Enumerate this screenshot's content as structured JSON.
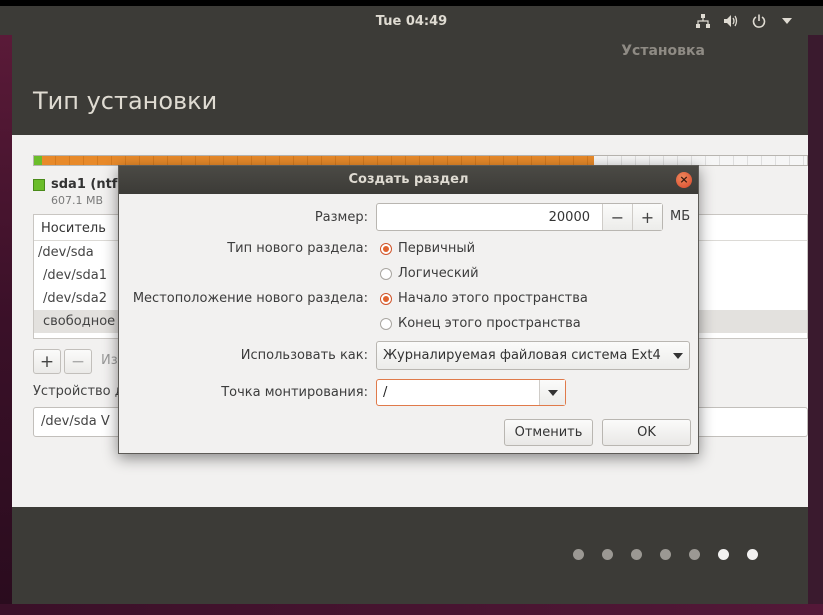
{
  "top_panel": {
    "clock": "Tue 04:49",
    "tray": [
      "network-icon",
      "volume-icon",
      "power-icon",
      "chevron-down-icon"
    ]
  },
  "installer": {
    "app_title": "Установка",
    "page_title": "Тип установки"
  },
  "partitions": {
    "legend_name": "sda1 (ntfs",
    "legend_size": "607.1 MB",
    "table_header": "Носитель",
    "rows": [
      "/dev/sda",
      "/dev/sda1",
      "/dev/sda2",
      "свободное"
    ],
    "add_label": "+",
    "remove_label": "−",
    "change_label": "Из",
    "boot_label": "Устройство д",
    "boot_value": "/dev/sda   V"
  },
  "progress": {
    "total_steps": 7,
    "current_step": 6
  },
  "dialog": {
    "title": "Создать раздел",
    "size_label": "Размер:",
    "size_value": "20000",
    "size_minus": "−",
    "size_plus": "+",
    "size_unit": "МБ",
    "type_label": "Тип нового раздела:",
    "type_primary": "Первичный",
    "type_logical": "Логический",
    "location_label": "Местоположение нового раздела:",
    "location_begin": "Начало этого пространства",
    "location_end": "Конец этого пространства",
    "use_as_label": "Использовать как:",
    "use_as_value": "Журналируемая файловая система Ext4",
    "mount_label": "Точка монтирования:",
    "mount_value": "/",
    "cancel": "Отменить",
    "ok": "OK"
  },
  "colors": {
    "accent": "#e0632e",
    "panel": "#3c3b37",
    "partition_ntfs": "#6bbd2a",
    "partition_used": "#e88a2a"
  }
}
